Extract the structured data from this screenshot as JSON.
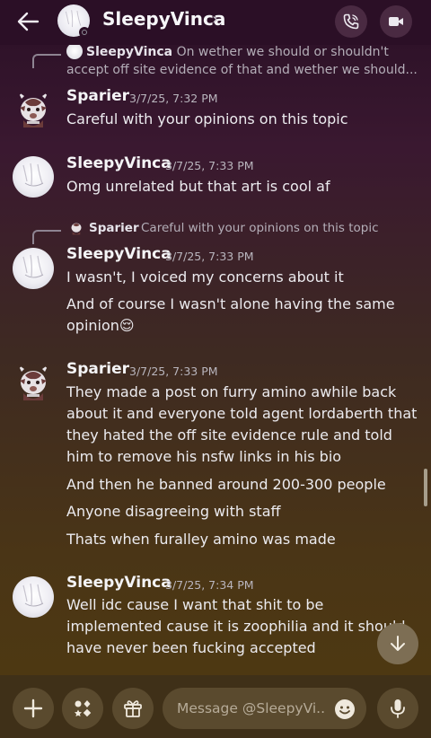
{
  "header": {
    "title": "SleepyVinca",
    "chevron": "›",
    "back_icon": "arrow-left-icon",
    "call_icon": "phone-icon",
    "video_icon": "video-camera-icon"
  },
  "messages": [
    {
      "reply": {
        "author": "SleepyVinca",
        "text": "On wether we should or shouldn't accept off site evidence of that and wether we should..."
      }
    },
    {
      "author": "Sparier",
      "timestamp": "3/7/25, 7:32 PM",
      "lines": [
        "Careful with your opinions on this topic"
      ]
    },
    {
      "author": "SleepyVinca",
      "timestamp": "3/7/25, 7:33 PM",
      "lines": [
        "Omg unrelated but that art is cool af"
      ]
    },
    {
      "reply": {
        "author": "Sparier",
        "text": "Careful with your opinions on this topic"
      },
      "author": "SleepyVinca",
      "timestamp": "3/7/25, 7:33 PM",
      "lines": [
        "I wasn't, I voiced my concerns about it",
        "And of course I wasn't alone having the same opinion😌"
      ]
    },
    {
      "author": "Sparier",
      "timestamp": "3/7/25, 7:33 PM",
      "lines": [
        "They made a post on furry amino awhile back about it and everyone told agent lordaberth that they hated the off site evidence rule and told him to remove his nsfw links in his bio",
        "And then he banned around 200-300 people",
        "Anyone disagreeing with staff",
        "Thats when furalley amino was made"
      ]
    },
    {
      "author": "SleepyVinca",
      "timestamp": "3/7/25, 7:34 PM",
      "lines": [
        "Well idc cause I want that shit to be implemented cause it is zoophilia and it should have never been fucking accepted"
      ]
    }
  ],
  "composer": {
    "placeholder": "Message @SleepyVi...",
    "plus_icon": "plus-icon",
    "apps_icon": "apps-icon",
    "gift_icon": "gift-icon",
    "emoji_icon": "emoji-icon",
    "mic_icon": "microphone-icon"
  },
  "colors": {
    "header_bg": "#2b0f26",
    "composer_bg": "#3f3018",
    "button_bg": "#5a4a2e"
  }
}
